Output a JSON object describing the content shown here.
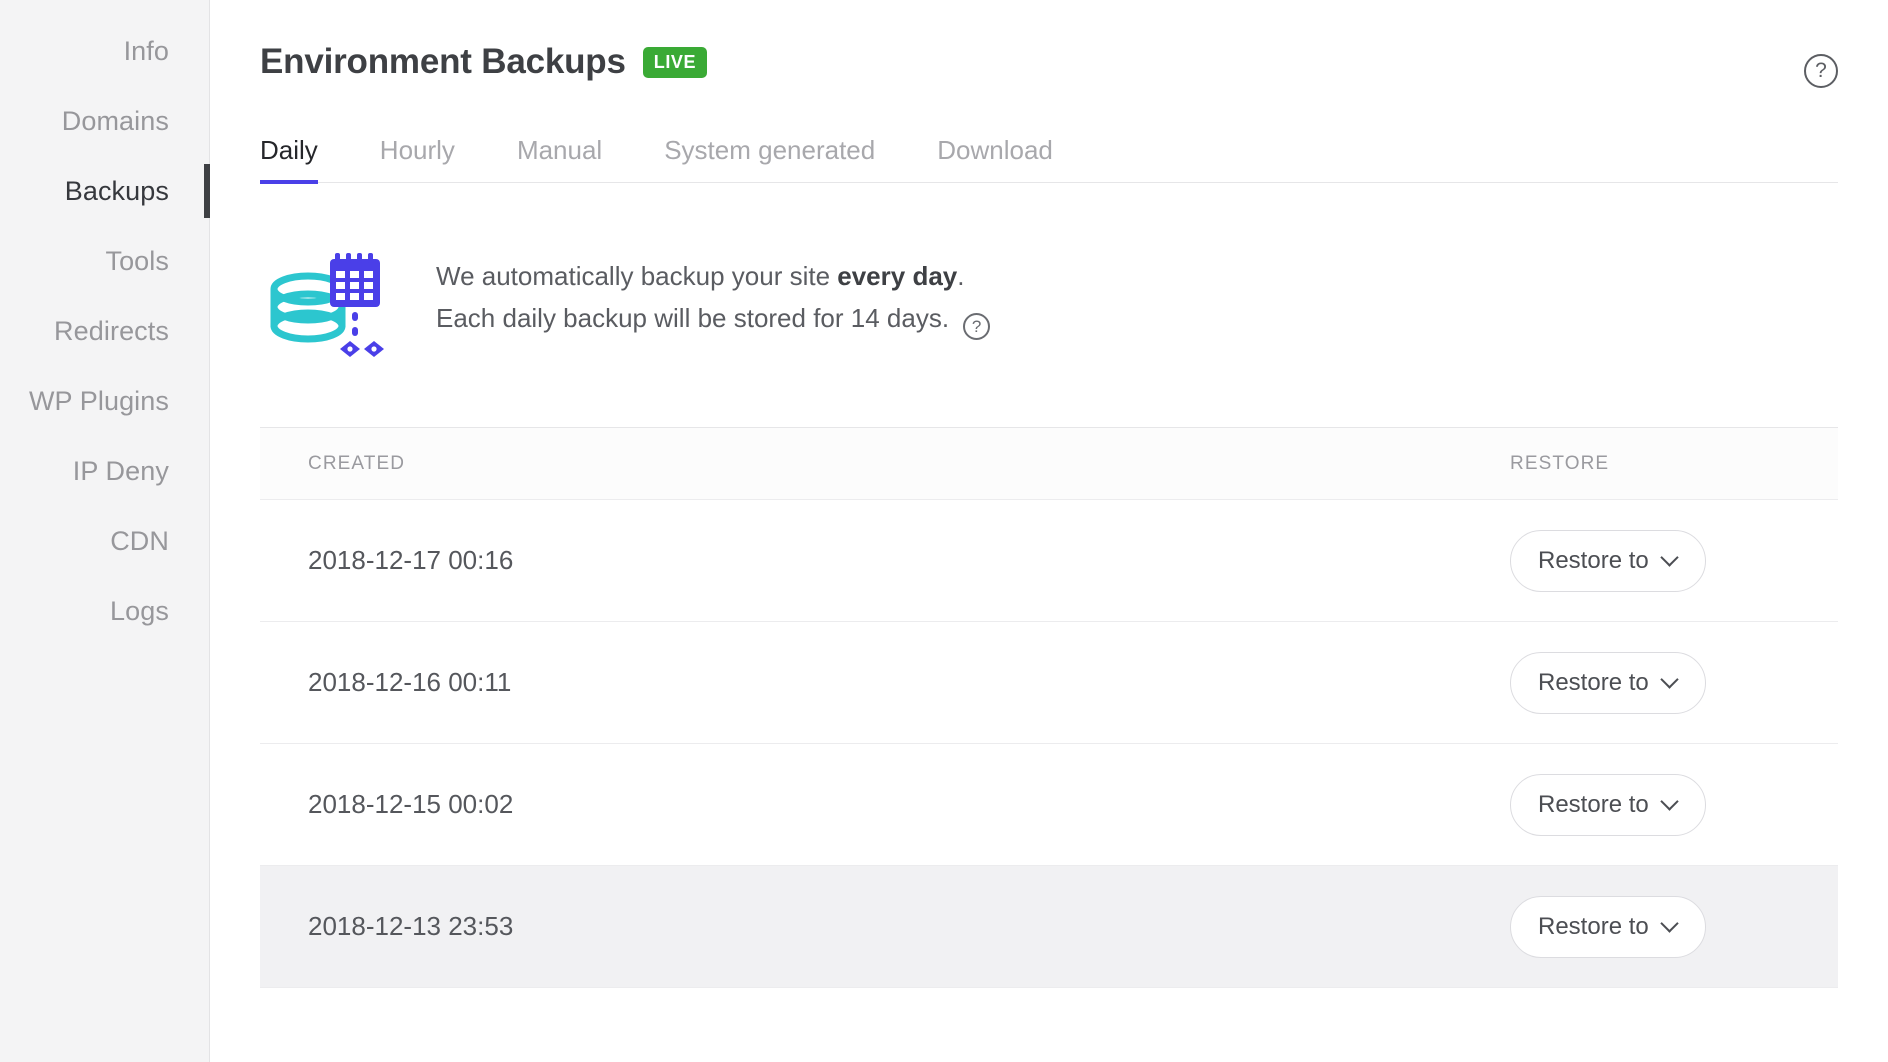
{
  "sidebar": {
    "items": [
      {
        "label": "Info",
        "active": false
      },
      {
        "label": "Domains",
        "active": false
      },
      {
        "label": "Backups",
        "active": true
      },
      {
        "label": "Tools",
        "active": false
      },
      {
        "label": "Redirects",
        "active": false
      },
      {
        "label": "WP Plugins",
        "active": false
      },
      {
        "label": "IP Deny",
        "active": false
      },
      {
        "label": "CDN",
        "active": false
      },
      {
        "label": "Logs",
        "active": false
      }
    ]
  },
  "header": {
    "title": "Environment Backups",
    "badge": "LIVE",
    "badge_color": "#3aaa35",
    "help_icon": "help-circle-icon",
    "help_glyph": "?"
  },
  "tabs": {
    "active_index": 0,
    "active_color": "#4a40e8",
    "items": [
      {
        "label": "Daily"
      },
      {
        "label": "Hourly"
      },
      {
        "label": "Manual"
      },
      {
        "label": "System generated"
      },
      {
        "label": "Download"
      }
    ]
  },
  "info": {
    "illustration": "database-calendar-backup-icon",
    "line1_prefix": "We automatically backup your site ",
    "line1_bold": "every day",
    "line1_suffix": ".",
    "line2": "Each daily backup will be stored for 14 days.",
    "help_glyph": "?"
  },
  "table": {
    "columns": [
      "CREATED",
      "RESTORE"
    ],
    "rows": [
      {
        "created": "2018-12-17 00:16",
        "restore_label": "Restore to",
        "highlight": false
      },
      {
        "created": "2018-12-16 00:11",
        "restore_label": "Restore to",
        "highlight": false
      },
      {
        "created": "2018-12-15 00:02",
        "restore_label": "Restore to",
        "highlight": false
      },
      {
        "created": "2018-12-13 23:53",
        "restore_label": "Restore to",
        "highlight": true
      }
    ]
  }
}
